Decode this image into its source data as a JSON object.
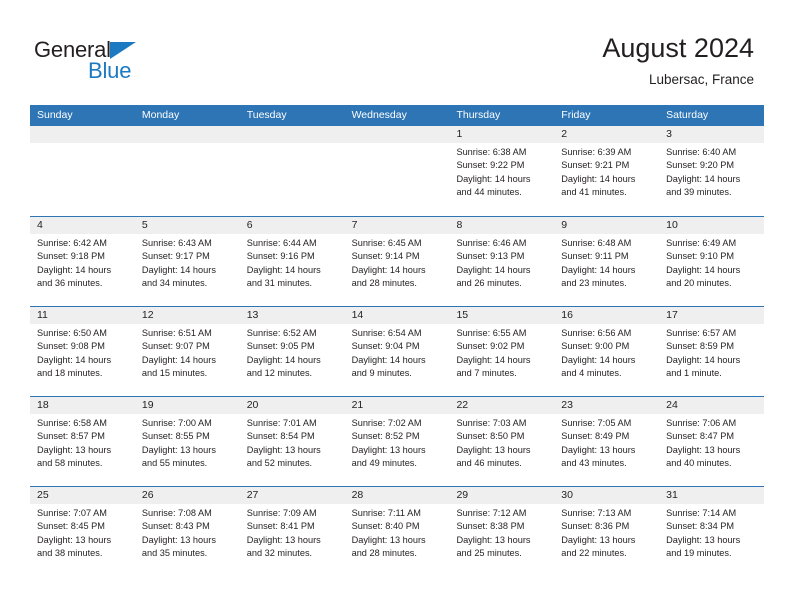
{
  "brand": {
    "name_part1": "General",
    "name_part2": "Blue",
    "logo_icon": "blue-triangle-icon",
    "accent_color": "#1b7ac2"
  },
  "header": {
    "title": "August 2024",
    "subtitle": "Lubersac, France"
  },
  "theme": {
    "header_bar": "#2e75b6",
    "day_band": "#efefef",
    "text": "#231f20"
  },
  "weekdays": [
    "Sunday",
    "Monday",
    "Tuesday",
    "Wednesday",
    "Thursday",
    "Friday",
    "Saturday"
  ],
  "weeks": [
    [
      {
        "day": "",
        "empty": true
      },
      {
        "day": "",
        "empty": true
      },
      {
        "day": "",
        "empty": true
      },
      {
        "day": "",
        "empty": true
      },
      {
        "day": "1",
        "sunrise": "Sunrise: 6:38 AM",
        "sunset": "Sunset: 9:22 PM",
        "daylight": "Daylight: 14 hours and 44 minutes."
      },
      {
        "day": "2",
        "sunrise": "Sunrise: 6:39 AM",
        "sunset": "Sunset: 9:21 PM",
        "daylight": "Daylight: 14 hours and 41 minutes."
      },
      {
        "day": "3",
        "sunrise": "Sunrise: 6:40 AM",
        "sunset": "Sunset: 9:20 PM",
        "daylight": "Daylight: 14 hours and 39 minutes."
      }
    ],
    [
      {
        "day": "4",
        "sunrise": "Sunrise: 6:42 AM",
        "sunset": "Sunset: 9:18 PM",
        "daylight": "Daylight: 14 hours and 36 minutes."
      },
      {
        "day": "5",
        "sunrise": "Sunrise: 6:43 AM",
        "sunset": "Sunset: 9:17 PM",
        "daylight": "Daylight: 14 hours and 34 minutes."
      },
      {
        "day": "6",
        "sunrise": "Sunrise: 6:44 AM",
        "sunset": "Sunset: 9:16 PM",
        "daylight": "Daylight: 14 hours and 31 minutes."
      },
      {
        "day": "7",
        "sunrise": "Sunrise: 6:45 AM",
        "sunset": "Sunset: 9:14 PM",
        "daylight": "Daylight: 14 hours and 28 minutes."
      },
      {
        "day": "8",
        "sunrise": "Sunrise: 6:46 AM",
        "sunset": "Sunset: 9:13 PM",
        "daylight": "Daylight: 14 hours and 26 minutes."
      },
      {
        "day": "9",
        "sunrise": "Sunrise: 6:48 AM",
        "sunset": "Sunset: 9:11 PM",
        "daylight": "Daylight: 14 hours and 23 minutes."
      },
      {
        "day": "10",
        "sunrise": "Sunrise: 6:49 AM",
        "sunset": "Sunset: 9:10 PM",
        "daylight": "Daylight: 14 hours and 20 minutes."
      }
    ],
    [
      {
        "day": "11",
        "sunrise": "Sunrise: 6:50 AM",
        "sunset": "Sunset: 9:08 PM",
        "daylight": "Daylight: 14 hours and 18 minutes."
      },
      {
        "day": "12",
        "sunrise": "Sunrise: 6:51 AM",
        "sunset": "Sunset: 9:07 PM",
        "daylight": "Daylight: 14 hours and 15 minutes."
      },
      {
        "day": "13",
        "sunrise": "Sunrise: 6:52 AM",
        "sunset": "Sunset: 9:05 PM",
        "daylight": "Daylight: 14 hours and 12 minutes."
      },
      {
        "day": "14",
        "sunrise": "Sunrise: 6:54 AM",
        "sunset": "Sunset: 9:04 PM",
        "daylight": "Daylight: 14 hours and 9 minutes."
      },
      {
        "day": "15",
        "sunrise": "Sunrise: 6:55 AM",
        "sunset": "Sunset: 9:02 PM",
        "daylight": "Daylight: 14 hours and 7 minutes."
      },
      {
        "day": "16",
        "sunrise": "Sunrise: 6:56 AM",
        "sunset": "Sunset: 9:00 PM",
        "daylight": "Daylight: 14 hours and 4 minutes."
      },
      {
        "day": "17",
        "sunrise": "Sunrise: 6:57 AM",
        "sunset": "Sunset: 8:59 PM",
        "daylight": "Daylight: 14 hours and 1 minute."
      }
    ],
    [
      {
        "day": "18",
        "sunrise": "Sunrise: 6:58 AM",
        "sunset": "Sunset: 8:57 PM",
        "daylight": "Daylight: 13 hours and 58 minutes."
      },
      {
        "day": "19",
        "sunrise": "Sunrise: 7:00 AM",
        "sunset": "Sunset: 8:55 PM",
        "daylight": "Daylight: 13 hours and 55 minutes."
      },
      {
        "day": "20",
        "sunrise": "Sunrise: 7:01 AM",
        "sunset": "Sunset: 8:54 PM",
        "daylight": "Daylight: 13 hours and 52 minutes."
      },
      {
        "day": "21",
        "sunrise": "Sunrise: 7:02 AM",
        "sunset": "Sunset: 8:52 PM",
        "daylight": "Daylight: 13 hours and 49 minutes."
      },
      {
        "day": "22",
        "sunrise": "Sunrise: 7:03 AM",
        "sunset": "Sunset: 8:50 PM",
        "daylight": "Daylight: 13 hours and 46 minutes."
      },
      {
        "day": "23",
        "sunrise": "Sunrise: 7:05 AM",
        "sunset": "Sunset: 8:49 PM",
        "daylight": "Daylight: 13 hours and 43 minutes."
      },
      {
        "day": "24",
        "sunrise": "Sunrise: 7:06 AM",
        "sunset": "Sunset: 8:47 PM",
        "daylight": "Daylight: 13 hours and 40 minutes."
      }
    ],
    [
      {
        "day": "25",
        "sunrise": "Sunrise: 7:07 AM",
        "sunset": "Sunset: 8:45 PM",
        "daylight": "Daylight: 13 hours and 38 minutes."
      },
      {
        "day": "26",
        "sunrise": "Sunrise: 7:08 AM",
        "sunset": "Sunset: 8:43 PM",
        "daylight": "Daylight: 13 hours and 35 minutes."
      },
      {
        "day": "27",
        "sunrise": "Sunrise: 7:09 AM",
        "sunset": "Sunset: 8:41 PM",
        "daylight": "Daylight: 13 hours and 32 minutes."
      },
      {
        "day": "28",
        "sunrise": "Sunrise: 7:11 AM",
        "sunset": "Sunset: 8:40 PM",
        "daylight": "Daylight: 13 hours and 28 minutes."
      },
      {
        "day": "29",
        "sunrise": "Sunrise: 7:12 AM",
        "sunset": "Sunset: 8:38 PM",
        "daylight": "Daylight: 13 hours and 25 minutes."
      },
      {
        "day": "30",
        "sunrise": "Sunrise: 7:13 AM",
        "sunset": "Sunset: 8:36 PM",
        "daylight": "Daylight: 13 hours and 22 minutes."
      },
      {
        "day": "31",
        "sunrise": "Sunrise: 7:14 AM",
        "sunset": "Sunset: 8:34 PM",
        "daylight": "Daylight: 13 hours and 19 minutes."
      }
    ]
  ]
}
